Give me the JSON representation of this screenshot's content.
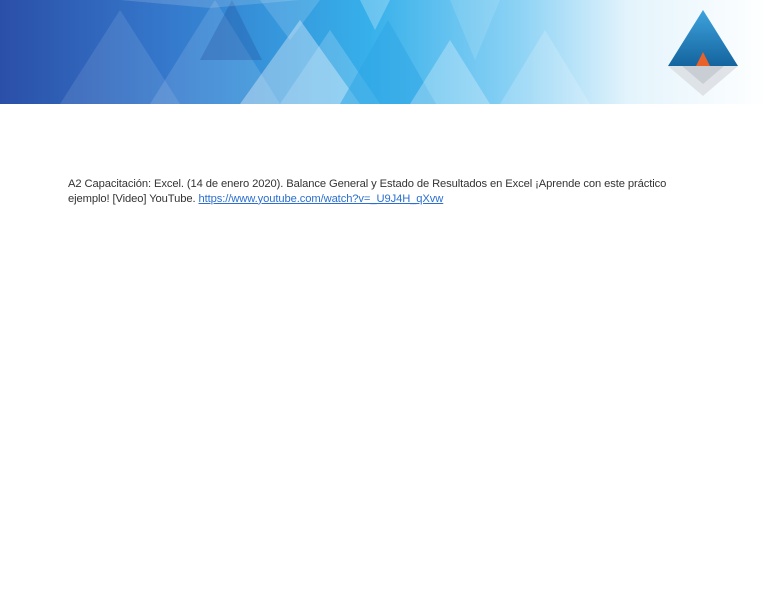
{
  "document": {
    "citation": {
      "text": "A2 Capacitación: Excel. (14 de enero 2020). Balance General y Estado de Resultados en Excel ¡Aprende con este práctico ejemplo! [Video] YouTube. ",
      "link": "https://www.youtube.com/watch?v=_U9J4H_qXvw"
    }
  },
  "header": {
    "logo_icon": "mountain-triangle-logo-icon"
  },
  "colors": {
    "banner_dark": "#2b4fa8",
    "banner_mid": "#2fa6e6",
    "banner_light": "#e8f5fd",
    "logo_blue": "#1e7fc0",
    "logo_orange": "#e8622a",
    "link": "#2c6fd0"
  }
}
